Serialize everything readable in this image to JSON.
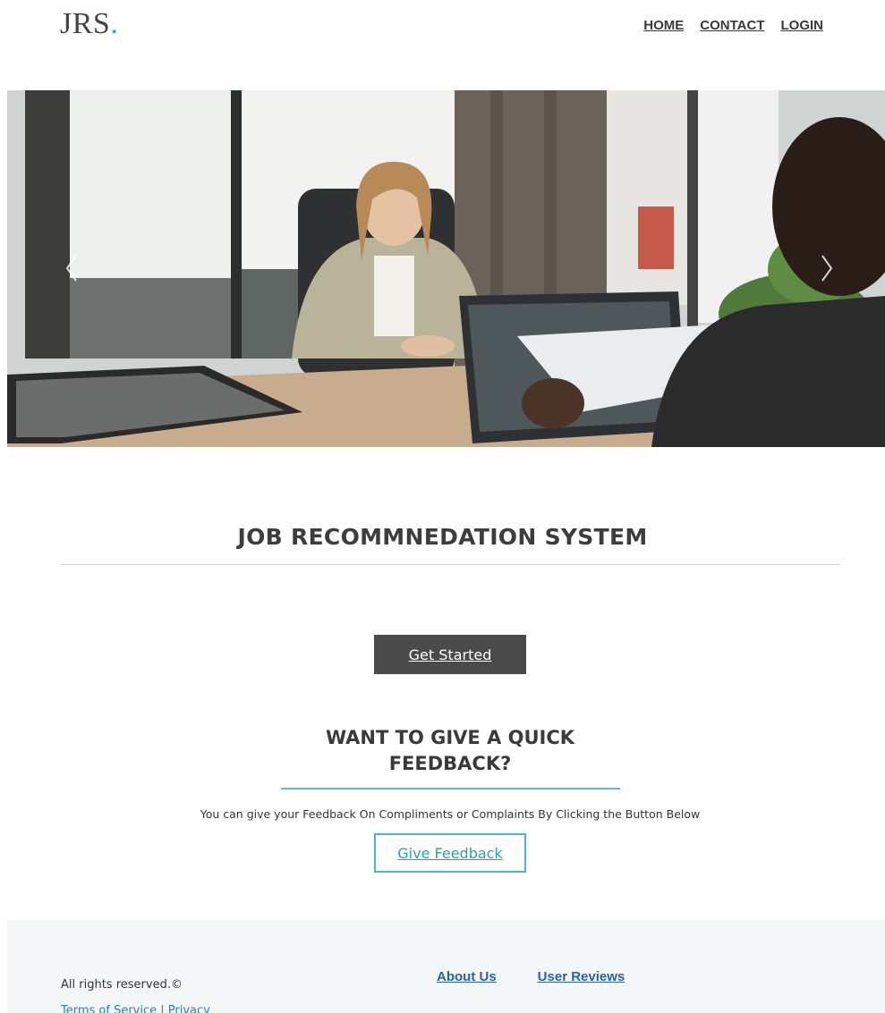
{
  "header": {
    "logo_text": "JRS",
    "logo_dot": ".",
    "nav": [
      {
        "label": "HOME"
      },
      {
        "label": "CONTACT"
      },
      {
        "label": "LOGIN"
      }
    ]
  },
  "hero": {
    "icons": {
      "prev": "chevron-left-icon",
      "next": "chevron-right-icon"
    }
  },
  "main": {
    "title": "JOB RECOMMNEDATION SYSTEM",
    "get_started_label": "Get Started"
  },
  "feedback": {
    "title_line1": "WANT TO GIVE A QUICK",
    "title_line2": "FEEDBACK?",
    "description": "You can give your Feedback On Compliments or Complaints By Clicking the Button Below",
    "button_label": "Give Feedback"
  },
  "footer": {
    "rights": "All rights reserved.©",
    "terms": "Terms of Service",
    "separator": " | ",
    "privacy": "Privacy",
    "links": [
      {
        "label": "About Us"
      },
      {
        "label": "User Reviews"
      }
    ]
  },
  "colors": {
    "accent": "#2aa9bf",
    "dark_button": "#4a4a4a",
    "footer_bg": "#f4f7f8",
    "footer_link": "#2b5fa8"
  }
}
